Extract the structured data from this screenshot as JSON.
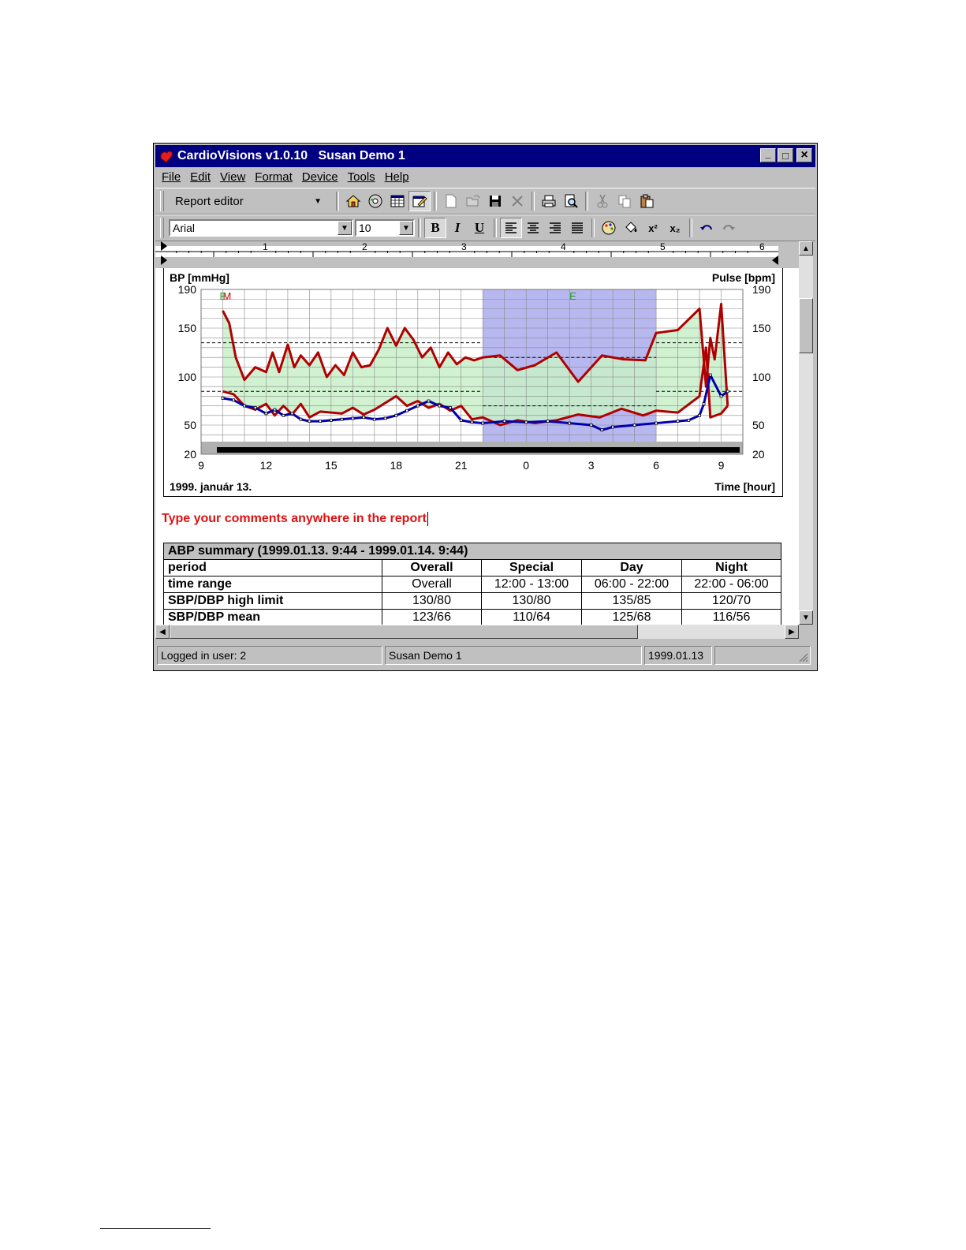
{
  "window": {
    "title": "CardioVisions v1.0.10   Susan Demo 1",
    "controls": {
      "minimize": "_",
      "maximize": "□",
      "close": "×"
    }
  },
  "menu": [
    "File",
    "Edit",
    "View",
    "Format",
    "Device",
    "Tools",
    "Help"
  ],
  "toolbar": {
    "mode_combo": "Report editor",
    "icons": [
      "home-icon",
      "disc-icon",
      "table-icon",
      "report-icon",
      "new-icon",
      "open-icon",
      "save-icon",
      "delete-icon",
      "print-icon",
      "print-preview-icon",
      "cut-icon",
      "copy-icon",
      "paste-icon"
    ]
  },
  "format_toolbar": {
    "font": "Arial",
    "size": "10",
    "bold": "B",
    "italic": "I",
    "underline": "U",
    "superscript": "x²",
    "subscript": "x₂"
  },
  "ruler": {
    "numbers": [
      "1",
      "2",
      "3",
      "4",
      "5",
      "6"
    ]
  },
  "chart_data": {
    "type": "line",
    "ylabel_left": "BP [mmHg]",
    "ylabel_right": "Pulse [bpm]",
    "xlabel": "Time [hour]",
    "date_label": "1999. január 13.",
    "x_ticks": [
      "9",
      "12",
      "15",
      "18",
      "21",
      "0",
      "3",
      "6",
      "9"
    ],
    "y_ticks": [
      190,
      150,
      100,
      50,
      20
    ],
    "ylim": [
      20,
      190
    ],
    "xlim_hours": [
      9,
      34
    ],
    "night_period_hours": [
      22,
      30
    ],
    "markers": [
      "M",
      "E",
      "E"
    ],
    "limits": {
      "sbp_day": 135,
      "dbp_day": 85,
      "sbp_night": 120,
      "dbp_night": 70
    },
    "series": [
      {
        "name": "SBP",
        "color": "#b00000",
        "x": [
          10,
          10.3,
          10.6,
          11,
          11.5,
          12,
          12.3,
          12.6,
          13,
          13.3,
          13.6,
          14,
          14.4,
          14.8,
          15.2,
          15.6,
          16,
          16.4,
          16.8,
          17.2,
          17.6,
          18,
          18.4,
          18.8,
          19.2,
          19.6,
          20,
          20.4,
          20.8,
          21.2,
          21.6,
          22,
          22.8,
          23.6,
          24.4,
          25.4,
          26.4,
          27.5,
          28.5,
          29.5,
          30,
          31,
          32,
          32.3,
          32.5,
          32.7,
          33,
          33.3
        ],
        "y": [
          168,
          155,
          120,
          97,
          110,
          105,
          125,
          105,
          133,
          110,
          122,
          112,
          125,
          100,
          112,
          102,
          125,
          110,
          112,
          128,
          150,
          132,
          150,
          138,
          120,
          130,
          110,
          125,
          113,
          120,
          117,
          120,
          122,
          107,
          112,
          125,
          95,
          122,
          118,
          117,
          145,
          148,
          170,
          90,
          140,
          118,
          175,
          70
        ]
      },
      {
        "name": "DBP",
        "color": "#b00000",
        "x": [
          10,
          10.5,
          11,
          11.5,
          12,
          12.4,
          12.8,
          13.2,
          13.6,
          14,
          14.5,
          15,
          15.5,
          16,
          16.5,
          17,
          17.5,
          18,
          18.5,
          19,
          19.5,
          20,
          20.5,
          21,
          21.5,
          22,
          22.8,
          23.6,
          24.4,
          25.4,
          26.4,
          27.4,
          28.4,
          29.4,
          30,
          31,
          32,
          32.3,
          32.5,
          33,
          33.3
        ],
        "y": [
          85,
          82,
          70,
          66,
          72,
          60,
          70,
          61,
          72,
          58,
          64,
          63,
          62,
          68,
          61,
          66,
          73,
          80,
          70,
          75,
          68,
          72,
          65,
          70,
          56,
          58,
          50,
          55,
          52,
          55,
          61,
          58,
          67,
          60,
          65,
          63,
          80,
          130,
          58,
          62,
          70
        ]
      },
      {
        "name": "Pulse",
        "color": "#0000b0",
        "x": [
          10,
          10.5,
          11,
          11.5,
          12,
          12.4,
          12.8,
          13.2,
          13.6,
          14,
          14.5,
          15,
          15.5,
          16,
          16.5,
          17,
          17.5,
          18,
          18.5,
          19,
          19.5,
          20,
          20.5,
          21,
          21.5,
          22,
          23,
          24,
          25,
          26,
          27,
          27.5,
          28,
          29,
          30,
          31,
          31.5,
          32,
          32.2,
          32.5,
          33,
          33.3
        ],
        "y": [
          78,
          76,
          70,
          68,
          62,
          66,
          60,
          62,
          56,
          54,
          54,
          55,
          56,
          57,
          58,
          56,
          57,
          60,
          65,
          70,
          75,
          70,
          68,
          55,
          53,
          52,
          54,
          53,
          54,
          52,
          50,
          45,
          48,
          50,
          52,
          54,
          55,
          60,
          72,
          102,
          80,
          85
        ]
      }
    ]
  },
  "comment": "Type your comments anywhere in the report",
  "summary": {
    "caption": "ABP summary  (1999.01.13. 9:44 - 1999.01.14. 9:44)",
    "headers": [
      "period",
      "Overall",
      "Special",
      "Day",
      "Night"
    ],
    "rows": [
      [
        "time range",
        "Overall",
        "12:00 - 13:00",
        "06:00 - 22:00",
        "22:00 - 06:00"
      ],
      [
        "SBP/DBP high limit",
        "130/80",
        "130/80",
        "135/85",
        "120/70"
      ],
      [
        "SBP/DBP mean",
        "123/66",
        "110/64",
        "125/68",
        "116/56"
      ]
    ]
  },
  "status": {
    "user": "Logged in user: 2",
    "patient": "Susan Demo 1",
    "date": "1999.01.13 "
  }
}
